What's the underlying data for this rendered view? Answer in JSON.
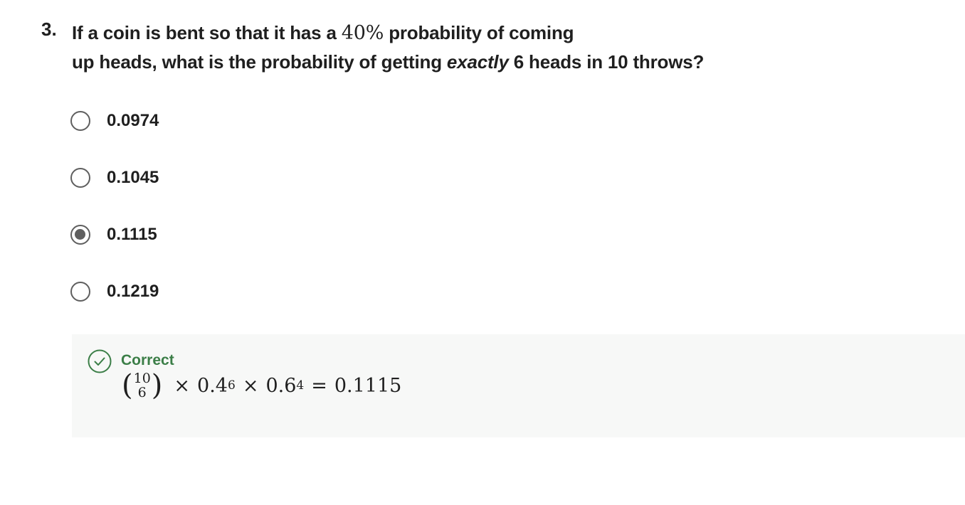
{
  "question": {
    "number": "3.",
    "line1_before": "If a coin is bent so that it has a ",
    "line1_math": "40%",
    "line1_after": " probability of coming",
    "line2_before": "up heads, what is the probability of getting ",
    "line2_emphasis": "exactly",
    "line2_after": " 6 heads in 10 throws?"
  },
  "options": [
    {
      "label": "0.0974",
      "selected": false
    },
    {
      "label": "0.1045",
      "selected": false
    },
    {
      "label": "0.1115",
      "selected": true
    },
    {
      "label": "0.1219",
      "selected": false
    }
  ],
  "feedback": {
    "status": "Correct",
    "status_color": "#3b7e47",
    "icon": "check-circle-icon",
    "formula": {
      "binom_top": "10",
      "binom_bottom": "6",
      "times1": "×",
      "base1": "0.4",
      "exp1": "6",
      "times2": "×",
      "base2": "0.6",
      "exp2": "4",
      "equals": "=",
      "result": "0.1115"
    }
  }
}
